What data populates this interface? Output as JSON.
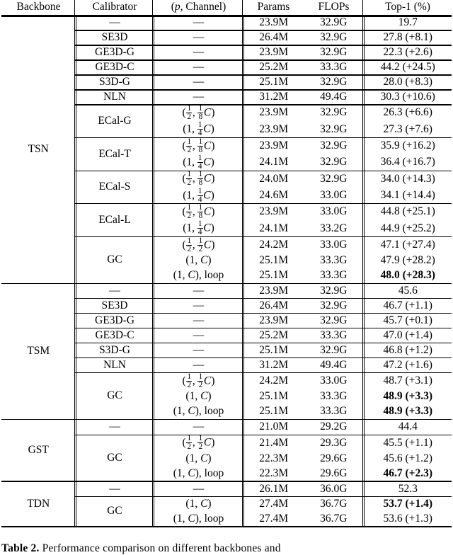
{
  "table": {
    "label": "performance-comparison-table",
    "columns": [
      {
        "key": "backbone",
        "header": "Backbone"
      },
      {
        "key": "calibrator",
        "header": "Calibrator"
      },
      {
        "key": "pchannel",
        "header": "(p, Channel)"
      },
      {
        "key": "params",
        "header": "Params"
      },
      {
        "key": "flops",
        "header": "FLOPs"
      },
      {
        "key": "top1",
        "header": "Top-1 (%)"
      }
    ],
    "dash": "—",
    "sections": [
      {
        "backbone": "TSN",
        "groups": [
          {
            "calibrator": "—",
            "rows": [
              {
                "pchannel": "—",
                "params": "23.9M",
                "flops": "32.9G",
                "top1": "19.7",
                "bold": false
              }
            ]
          },
          {
            "calibrator": "SE3D",
            "merged": false,
            "rows": [
              {
                "pchannel": "—",
                "params": "26.4M",
                "flops": "32.9G",
                "top1": "27.8 (+8.1)",
                "bold": false
              }
            ]
          },
          {
            "calibrator": "GE3D-G",
            "merged": false,
            "rows": [
              {
                "pchannel": "—",
                "params": "23.9M",
                "flops": "32.9G",
                "top1": "22.3 (+2.6)",
                "bold": false
              }
            ]
          },
          {
            "calibrator": "GE3D-C",
            "merged": false,
            "rows": [
              {
                "pchannel": "—",
                "params": "25.2M",
                "flops": "33.3G",
                "top1": "44.2 (+24.5)",
                "bold": false
              }
            ]
          },
          {
            "calibrator": "S3D-G",
            "merged": false,
            "rows": [
              {
                "pchannel": "—",
                "params": "25.1M",
                "flops": "32.9G",
                "top1": "28.0 (+8.3)",
                "bold": false
              }
            ]
          },
          {
            "calibrator": "NLN",
            "merged": false,
            "rows": [
              {
                "pchannel": "—",
                "params": "31.2M",
                "flops": "49.4G",
                "top1": "30.3 (+10.6)",
                "bold": false
              }
            ]
          },
          {
            "calibrator": "ECal-G",
            "rows": [
              {
                "pchannel": "frac:1/2,1/8C",
                "params": "23.9M",
                "flops": "32.9G",
                "top1": "26.3 (+6.6)",
                "bold": false
              },
              {
                "pchannel": "frac:1,1/4C",
                "params": "23.9M",
                "flops": "32.9G",
                "top1": "27.3 (+7.6)",
                "bold": false
              }
            ]
          },
          {
            "calibrator": "ECal-T",
            "rows": [
              {
                "pchannel": "frac:1/2,1/8C",
                "params": "23.9M",
                "flops": "32.9G",
                "top1": "35.9 (+16.2)",
                "bold": false
              },
              {
                "pchannel": "frac:1,1/4C",
                "params": "24.1M",
                "flops": "32.9G",
                "top1": "36.4 (+16.7)",
                "bold": false
              }
            ]
          },
          {
            "calibrator": "ECal-S",
            "rows": [
              {
                "pchannel": "frac:1/2,1/8C",
                "params": "24.0M",
                "flops": "32.9G",
                "top1": "34.0 (+14.3)",
                "bold": false
              },
              {
                "pchannel": "frac:1,1/4C",
                "params": "24.6M",
                "flops": "33.0G",
                "top1": "34.1 (+14.4)",
                "bold": false
              }
            ]
          },
          {
            "calibrator": "ECal-L",
            "rows": [
              {
                "pchannel": "frac:1/2,1/8C",
                "params": "23.9M",
                "flops": "33.0G",
                "top1": "44.8 (+25.1)",
                "bold": false
              },
              {
                "pchannel": "frac:1,1/4C",
                "params": "24.1M",
                "flops": "33.2G",
                "top1": "44.9 (+25.2)",
                "bold": false
              }
            ]
          },
          {
            "calibrator": "GC",
            "rows": [
              {
                "pchannel": "frac:1/2,1/2C",
                "params": "24.2M",
                "flops": "33.0G",
                "top1": "47.1 (+27.4)",
                "bold": false
              },
              {
                "pchannel": "plain:(1, C)",
                "params": "25.1M",
                "flops": "33.3G",
                "top1": "47.9 (+28.2)",
                "bold": false
              },
              {
                "pchannel": "plain:(1, C), loop",
                "params": "25.1M",
                "flops": "33.3G",
                "top1": "48.0 (+28.3)",
                "bold": true
              }
            ]
          }
        ]
      },
      {
        "backbone": "TSM",
        "groups": [
          {
            "calibrator": "—",
            "rows": [
              {
                "pchannel": "—",
                "params": "23.9M",
                "flops": "32.9G",
                "top1": "45.6",
                "bold": false
              }
            ]
          },
          {
            "calibrator": "SE3D",
            "rows": [
              {
                "pchannel": "—",
                "params": "26.4M",
                "flops": "32.9G",
                "top1": "46.7 (+1.1)",
                "bold": false
              }
            ]
          },
          {
            "calibrator": "GE3D-G",
            "rows": [
              {
                "pchannel": "—",
                "params": "23.9M",
                "flops": "32.9G",
                "top1": "45.7 (+0.1)",
                "bold": false
              }
            ]
          },
          {
            "calibrator": "GE3D-C",
            "rows": [
              {
                "pchannel": "—",
                "params": "25.2M",
                "flops": "33.3G",
                "top1": "47.0 (+1.4)",
                "bold": false
              }
            ]
          },
          {
            "calibrator": "S3D-G",
            "rows": [
              {
                "pchannel": "—",
                "params": "25.1M",
                "flops": "32.9G",
                "top1": "46.8 (+1.2)",
                "bold": false
              }
            ]
          },
          {
            "calibrator": "NLN",
            "rows": [
              {
                "pchannel": "—",
                "params": "31.2M",
                "flops": "49.4G",
                "top1": "47.2 (+1.6)",
                "bold": false
              }
            ]
          },
          {
            "calibrator": "GC",
            "rows": [
              {
                "pchannel": "frac:1/2,1/2C",
                "params": "24.2M",
                "flops": "33.0G",
                "top1": "48.7 (+3.1)",
                "bold": false
              },
              {
                "pchannel": "plain:(1, C)",
                "params": "25.1M",
                "flops": "33.3G",
                "top1": "48.9 (+3.3)",
                "bold": true
              },
              {
                "pchannel": "plain:(1, C), loop",
                "params": "25.1M",
                "flops": "33.3G",
                "top1": "48.9 (+3.3)",
                "bold": true
              }
            ]
          }
        ]
      },
      {
        "backbone": "GST",
        "groups": [
          {
            "calibrator": "—",
            "rows": [
              {
                "pchannel": "—",
                "params": "21.0M",
                "flops": "29.2G",
                "top1": "44.4",
                "bold": false
              }
            ]
          },
          {
            "calibrator": "GC",
            "rows": [
              {
                "pchannel": "frac:1/2,1/2C",
                "params": "21.4M",
                "flops": "29.3G",
                "top1": "45.5 (+1.1)",
                "bold": false
              },
              {
                "pchannel": "plain:(1, C)",
                "params": "22.3M",
                "flops": "29.6G",
                "top1": "45.6 (+1.2)",
                "bold": false
              },
              {
                "pchannel": "plain:(1, C), loop",
                "params": "22.3M",
                "flops": "29.6G",
                "top1": "46.7 (+2.3)",
                "bold": true
              }
            ]
          }
        ]
      },
      {
        "backbone": "TDN",
        "groups": [
          {
            "calibrator": "—",
            "rows": [
              {
                "pchannel": "—",
                "params": "26.1M",
                "flops": "36.0G",
                "top1": "52.3",
                "bold": false
              }
            ]
          },
          {
            "calibrator": "GC",
            "rows": [
              {
                "pchannel": "plain:(1, C)",
                "params": "27.4M",
                "flops": "36.7G",
                "top1": "53.7 (+1.4)",
                "bold": true
              },
              {
                "pchannel": "plain:(1, C), loop",
                "params": "27.4M",
                "flops": "36.7G",
                "top1": "53.6 (+1.3)",
                "bold": false
              }
            ]
          }
        ]
      }
    ]
  },
  "caption": {
    "label": "Table 2.",
    "text": "Performance comparison on different backbones and"
  },
  "colors": {
    "rule": "#000000",
    "text": "#000000",
    "background": "#ffffff"
  }
}
